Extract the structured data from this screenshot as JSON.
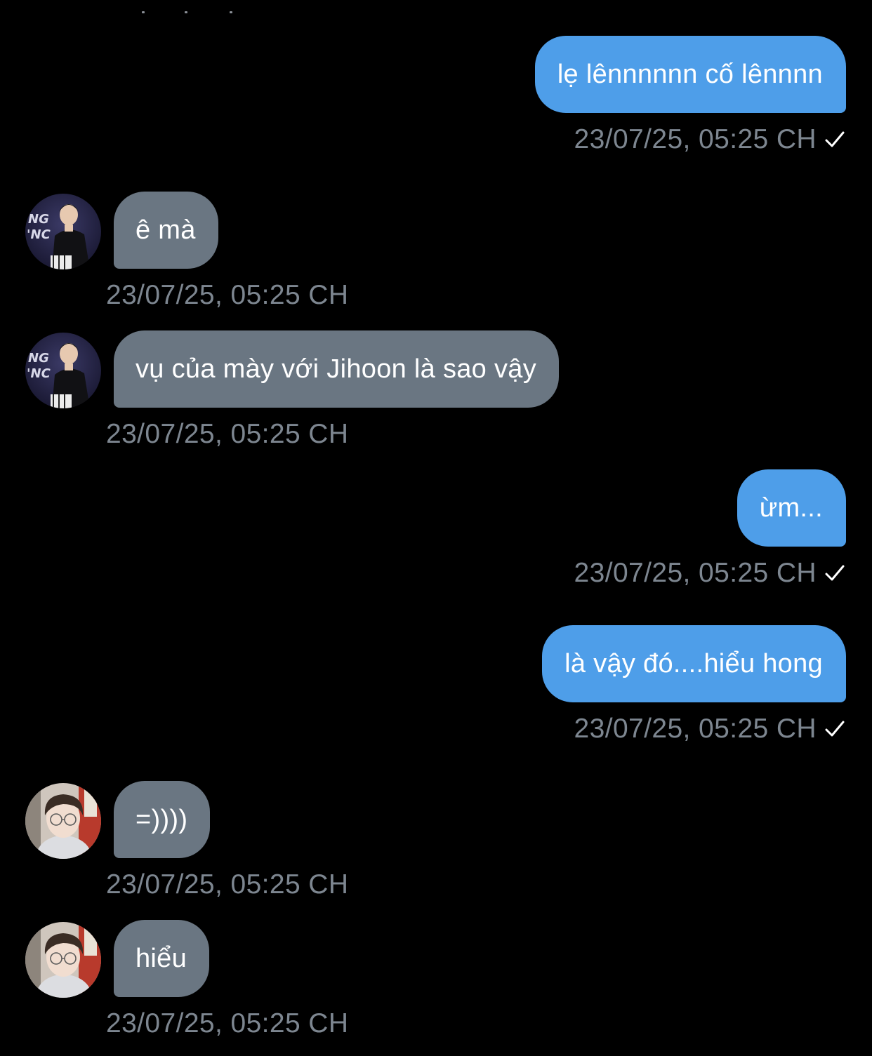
{
  "messages": [
    {
      "side": "out",
      "text": "lẹ lênnnnnn cố lênnnn",
      "time": "23/07/25, 05:25 CH",
      "status": "sent-check"
    },
    {
      "side": "in",
      "text": "ê mà",
      "time": "23/07/25, 05:25 CH",
      "avatar": "avatar-performer"
    },
    {
      "side": "in",
      "text": "vụ của mày với Jihoon là sao vậy",
      "time": "23/07/25, 05:25 CH",
      "avatar": "avatar-performer"
    },
    {
      "side": "out",
      "text": "ừm...",
      "time": "23/07/25, 05:25 CH",
      "status": "sent-check"
    },
    {
      "side": "out",
      "text": "là vậy đó....hiểu hong",
      "time": "23/07/25, 05:25 CH",
      "status": "sent-check"
    },
    {
      "side": "in",
      "text": "=))))",
      "time": "23/07/25, 05:25 CH",
      "avatar": "avatar-glasses"
    },
    {
      "side": "in",
      "text": "hiểu",
      "time": "23/07/25, 05:25 CH",
      "avatar": "avatar-glasses"
    }
  ],
  "colors": {
    "background": "#000000",
    "outgoing_bubble": "#4e9ee9",
    "incoming_bubble": "#6a7682",
    "timestamp": "#7d8690",
    "bubble_text": "#ffffff"
  }
}
